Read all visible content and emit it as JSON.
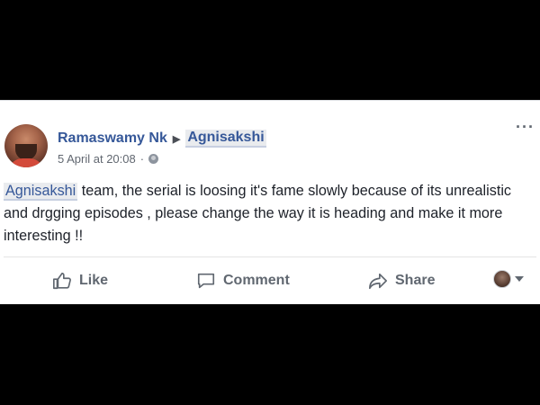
{
  "post": {
    "author": "Ramaswamy Nk",
    "target_page": "Agnisakshi",
    "timestamp": "5 April at 20:08",
    "privacy_icon": "globe-icon",
    "more_icon": "ellipsis-icon",
    "body": {
      "mention": "Agnisakshi",
      "text": " team, the serial is loosing it's fame slowly because of its unrealistic and drgging episodes , please change the way it is heading and make it more interesting !!"
    }
  },
  "actions": {
    "like_label": "Like",
    "comment_label": "Comment",
    "share_label": "Share"
  },
  "colors": {
    "link": "#365899",
    "text": "#1d2129",
    "muted": "#606770",
    "background_band": "#000000"
  }
}
